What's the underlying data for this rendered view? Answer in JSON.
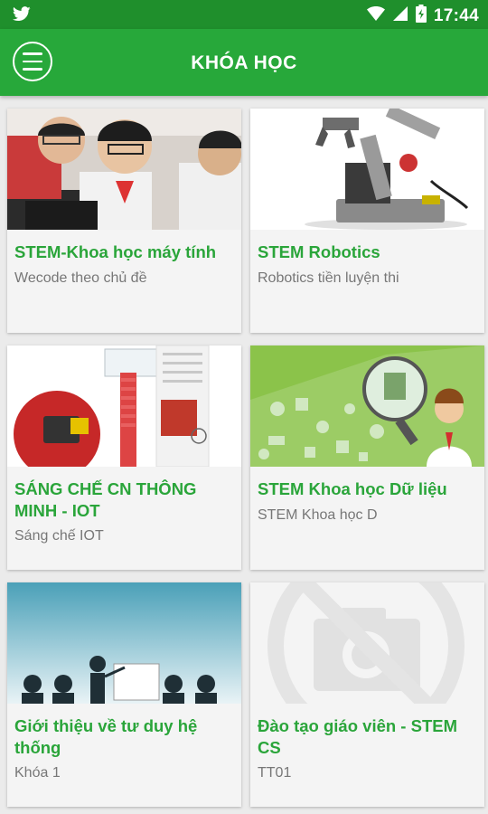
{
  "status_bar": {
    "time": "17:44"
  },
  "app_bar": {
    "title": "KHÓA HỌC"
  },
  "courses": [
    {
      "title": "STEM-Khoa học máy tính",
      "subtitle": "Wecode theo chủ đề"
    },
    {
      "title": "STEM Robotics",
      "subtitle": "Robotics tiền luyện thi"
    },
    {
      "title": "SÁNG CHẾ CN THÔNG MINH - IOT",
      "subtitle": "Sáng chế IOT"
    },
    {
      "title": "STEM Khoa học Dữ liệu",
      "subtitle": "STEM Khoa học D"
    },
    {
      "title": "Giới thiệu về tư duy hệ thống",
      "subtitle": "Khóa 1"
    },
    {
      "title": "Đào tạo giáo viên - STEM CS",
      "subtitle": "TT01"
    }
  ]
}
